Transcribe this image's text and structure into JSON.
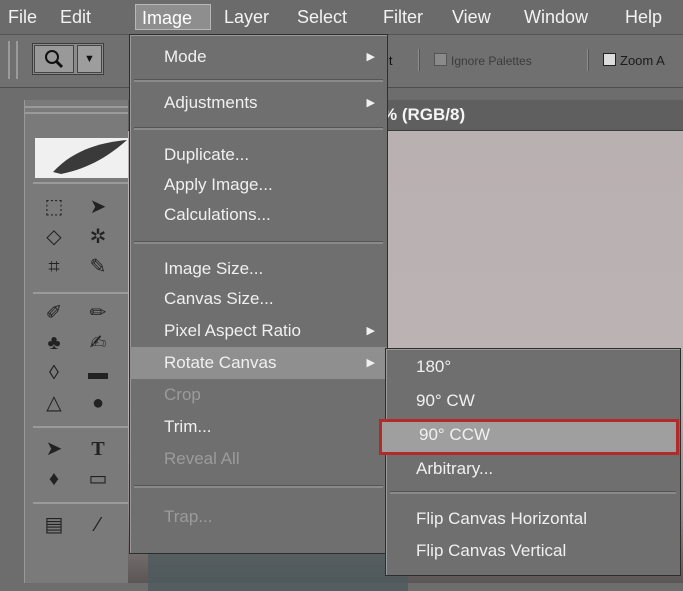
{
  "menubar": {
    "items": [
      "File",
      "Edit",
      "Image",
      "Layer",
      "Select",
      "Filter",
      "View",
      "Window",
      "Help"
    ],
    "active": "Image"
  },
  "options": {
    "fit_fragment": "it",
    "ignore_palettes": "Ignore Palettes",
    "zoom_all": "Zoom A"
  },
  "document": {
    "title_fragment": "% (RGB/8)"
  },
  "image_menu": {
    "items": [
      {
        "label": "Mode",
        "submenu": true,
        "enabled": true
      },
      {
        "label": "Adjustments",
        "submenu": true,
        "enabled": true
      },
      {
        "label": "Duplicate...",
        "enabled": true
      },
      {
        "label": "Apply Image...",
        "enabled": true
      },
      {
        "label": "Calculations...",
        "enabled": true
      },
      {
        "label": "Image Size...",
        "enabled": true
      },
      {
        "label": "Canvas Size...",
        "enabled": true
      },
      {
        "label": "Pixel Aspect Ratio",
        "submenu": true,
        "enabled": true
      },
      {
        "label": "Rotate Canvas",
        "submenu": true,
        "enabled": true,
        "highlighted": true
      },
      {
        "label": "Crop",
        "enabled": false
      },
      {
        "label": "Trim...",
        "enabled": true
      },
      {
        "label": "Reveal All",
        "enabled": false
      },
      {
        "label": "Trap...",
        "enabled": false
      }
    ]
  },
  "rotate_submenu": {
    "items": [
      {
        "label": "180°"
      },
      {
        "label": "90° CW"
      },
      {
        "label": "90° CCW",
        "selected": true
      },
      {
        "label": "Arbitrary..."
      },
      {
        "label": "Flip Canvas Horizontal"
      },
      {
        "label": "Flip Canvas Vertical"
      }
    ]
  },
  "icons": {
    "zoom_tool": "magnifier-icon",
    "dropdown": "triangle-down-icon",
    "submenu_arrow": "triangle-right-icon"
  },
  "colors": {
    "highlight": "#8f8f8f",
    "selection_border": "#b22a2a",
    "menu_bg": "#6f6f6f"
  }
}
